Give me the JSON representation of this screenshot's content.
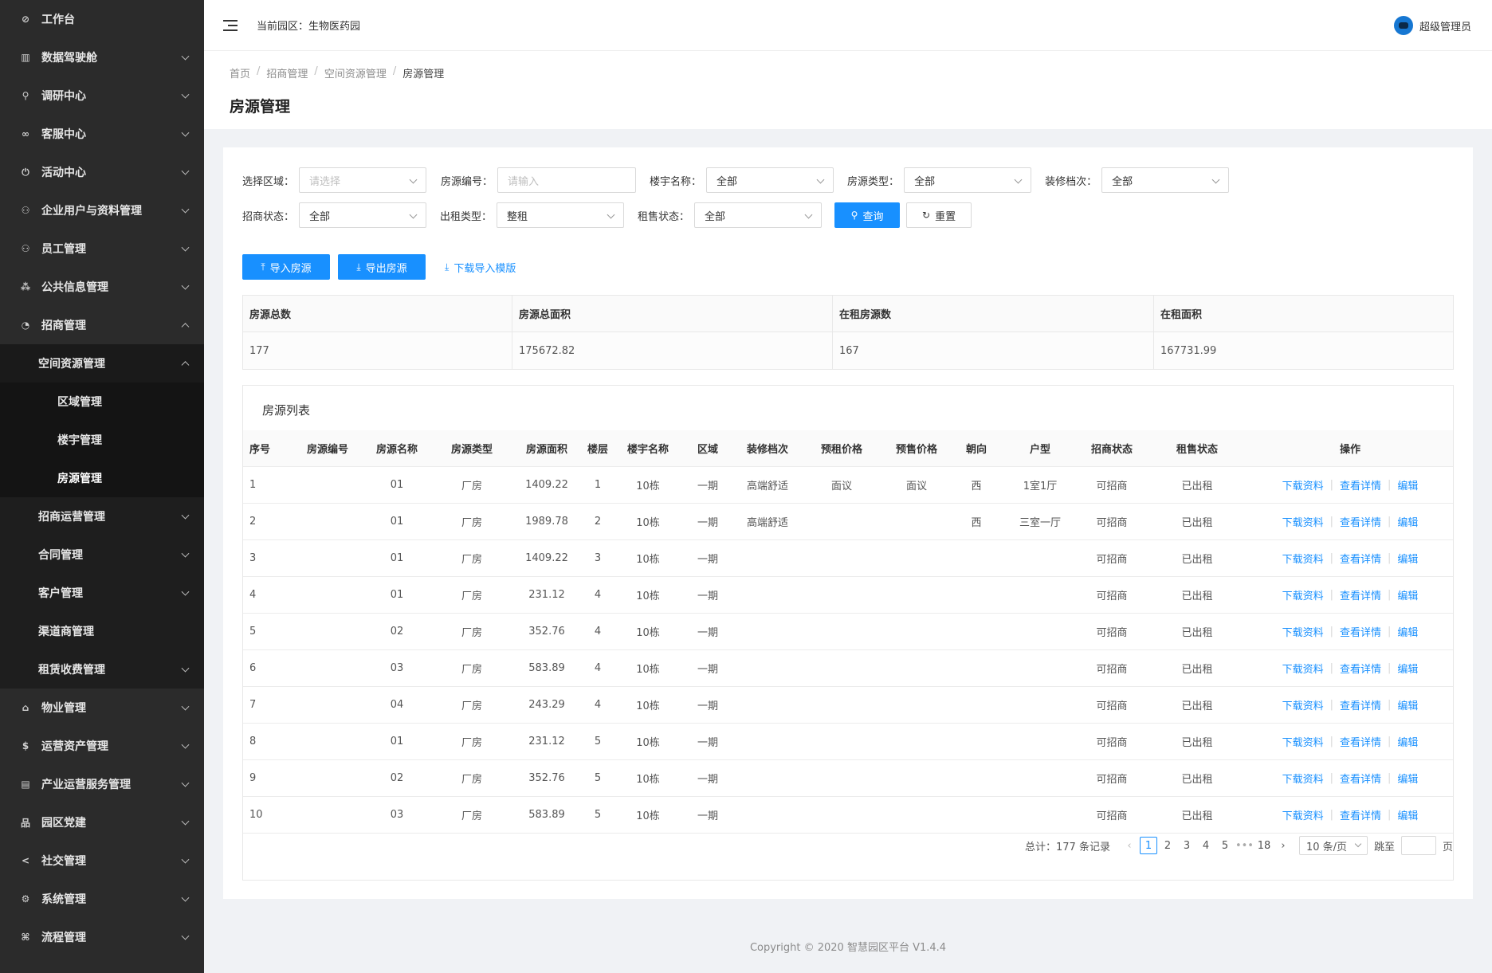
{
  "sidebar": {
    "items": [
      {
        "label": "工作台",
        "icon": "dashboard-icon",
        "glyph": "⊘",
        "chevron": "none"
      },
      {
        "label": "数据驾驶舱",
        "icon": "bar-chart-icon",
        "glyph": "▥",
        "chevron": "down"
      },
      {
        "label": "调研中心",
        "icon": "search-icon",
        "glyph": "⚲",
        "chevron": "down"
      },
      {
        "label": "客服中心",
        "icon": "link-icon",
        "glyph": "∞",
        "chevron": "down"
      },
      {
        "label": "活动中心",
        "icon": "power-icon",
        "glyph": "⏻",
        "chevron": "down"
      },
      {
        "label": "企业用户与资料管理",
        "icon": "users-icon",
        "glyph": "⚇",
        "chevron": "down"
      },
      {
        "label": "员工管理",
        "icon": "team-icon",
        "glyph": "⚇",
        "chevron": "down"
      },
      {
        "label": "公共信息管理",
        "icon": "cluster-icon",
        "glyph": "⁂",
        "chevron": "down"
      },
      {
        "label": "招商管理",
        "icon": "pie-chart-icon",
        "glyph": "◔",
        "chevron": "up"
      }
    ],
    "sub": {
      "space_head": "空间资源管理",
      "space_children": [
        "区域管理",
        "楼宇管理",
        "房源管理"
      ],
      "others": [
        "招商运营管理",
        "合同管理",
        "客户管理",
        "渠道商管理",
        "租赁收费管理"
      ],
      "others_chevron": [
        true,
        true,
        true,
        false,
        true
      ]
    },
    "bottom": [
      {
        "label": "物业管理",
        "icon": "home-icon",
        "glyph": "⌂"
      },
      {
        "label": "运营资产管理",
        "icon": "dollar-icon",
        "glyph": "$"
      },
      {
        "label": "产业运营服务管理",
        "icon": "file-icon",
        "glyph": "▤"
      },
      {
        "label": "园区党建",
        "icon": "flag-icon",
        "glyph": "品"
      },
      {
        "label": "社交管理",
        "icon": "share-icon",
        "glyph": "<"
      },
      {
        "label": "系统管理",
        "icon": "setting-icon",
        "glyph": "⚙"
      },
      {
        "label": "流程管理",
        "icon": "flow-icon",
        "glyph": "⌘"
      }
    ]
  },
  "header": {
    "park_label": "当前园区：生物医药园",
    "user_name": "超级管理员"
  },
  "breadcrumb": [
    "首页",
    "招商管理",
    "空间资源管理",
    "房源管理"
  ],
  "page_title": "房源管理",
  "filters": {
    "region_label": "选择区域：",
    "region_placeholder": "请选择",
    "code_label": "房源编号：",
    "code_placeholder": "请输入",
    "building_label": "楼宇名称：",
    "building_value": "全部",
    "type_label": "房源类型：",
    "type_value": "全部",
    "decor_label": "装修档次：",
    "decor_value": "全部",
    "invest_label": "招商状态：",
    "invest_value": "全部",
    "rent_type_label": "出租类型：",
    "rent_type_value": "整租",
    "lease_label": "租售状态：",
    "lease_value": "全部",
    "query_btn": "查询",
    "reset_btn": "重置"
  },
  "actions": {
    "import_btn": "导入房源",
    "export_btn": "导出房源",
    "template_link": "下载导入模版"
  },
  "summary": {
    "headers": [
      "房源总数",
      "房源总面积",
      "在租房源数",
      "在租面积"
    ],
    "values": [
      "177",
      "175672.82",
      "167",
      "167731.99"
    ]
  },
  "list": {
    "title": "房源列表",
    "columns": [
      "序号",
      "房源编号",
      "房源名称",
      "房源类型",
      "房源面积",
      "楼层",
      "楼宇名称",
      "区域",
      "装修档次",
      "预租价格",
      "预售价格",
      "朝向",
      "户型",
      "招商状态",
      "租售状态",
      "操作"
    ],
    "rows": [
      [
        "1",
        "",
        "01",
        "厂房",
        "1409.22",
        "1",
        "10栋",
        "一期",
        "高端舒适",
        "面议",
        "面议",
        "西",
        "1室1厅",
        "可招商",
        "已出租"
      ],
      [
        "2",
        "",
        "01",
        "厂房",
        "1989.78",
        "2",
        "10栋",
        "一期",
        "高端舒适",
        "",
        "",
        "西",
        "三室一厅",
        "可招商",
        "已出租"
      ],
      [
        "3",
        "",
        "01",
        "厂房",
        "1409.22",
        "3",
        "10栋",
        "一期",
        "",
        "",
        "",
        "",
        "",
        "可招商",
        "已出租"
      ],
      [
        "4",
        "",
        "01",
        "厂房",
        "231.12",
        "4",
        "10栋",
        "一期",
        "",
        "",
        "",
        "",
        "",
        "可招商",
        "已出租"
      ],
      [
        "5",
        "",
        "02",
        "厂房",
        "352.76",
        "4",
        "10栋",
        "一期",
        "",
        "",
        "",
        "",
        "",
        "可招商",
        "已出租"
      ],
      [
        "6",
        "",
        "03",
        "厂房",
        "583.89",
        "4",
        "10栋",
        "一期",
        "",
        "",
        "",
        "",
        "",
        "可招商",
        "已出租"
      ],
      [
        "7",
        "",
        "04",
        "厂房",
        "243.29",
        "4",
        "10栋",
        "一期",
        "",
        "",
        "",
        "",
        "",
        "可招商",
        "已出租"
      ],
      [
        "8",
        "",
        "01",
        "厂房",
        "231.12",
        "5",
        "10栋",
        "一期",
        "",
        "",
        "",
        "",
        "",
        "可招商",
        "已出租"
      ],
      [
        "9",
        "",
        "02",
        "厂房",
        "352.76",
        "5",
        "10栋",
        "一期",
        "",
        "",
        "",
        "",
        "",
        "可招商",
        "已出租"
      ],
      [
        "10",
        "",
        "03",
        "厂房",
        "583.89",
        "5",
        "10栋",
        "一期",
        "",
        "",
        "",
        "",
        "",
        "可招商",
        "已出租"
      ]
    ],
    "ops": [
      "下载资料",
      "查看详情",
      "编辑"
    ]
  },
  "pagination": {
    "total_text": "总计：177 条记录",
    "pages": [
      "1",
      "2",
      "3",
      "4",
      "5",
      "•••",
      "18"
    ],
    "current": "1",
    "page_size": "10 条/页",
    "jump_label": "跳至",
    "page_suffix": "页"
  },
  "footer": "Copyright © 2020 智慧园区平台 V1.4.4",
  "colors": {
    "primary": "#1890ff",
    "sidebar_bg": "#2b2b2b"
  }
}
